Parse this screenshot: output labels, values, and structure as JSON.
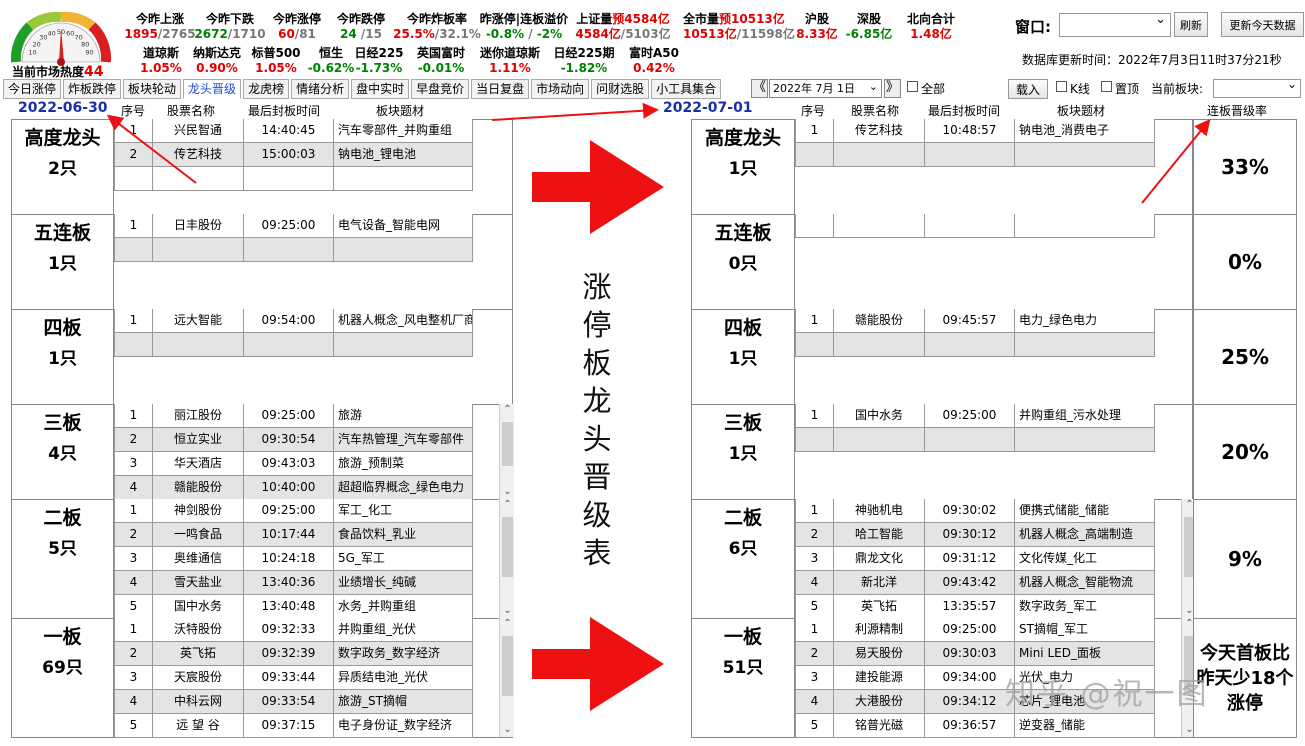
{
  "gauge": {
    "label": "当前市场热度",
    "value": "44",
    "ticks": [
      "10",
      "20",
      "30",
      "40",
      "50",
      "60",
      "70",
      "80",
      "90"
    ]
  },
  "stats_row1": [
    {
      "label": "今昨上涨",
      "a": "1895",
      "b": "2765",
      "sep": "/",
      "ac": "red",
      "bc": "gray"
    },
    {
      "label": "今昨下跌",
      "a": "2672",
      "b": "1710",
      "sep": "/",
      "ac": "green",
      "bc": "gray"
    },
    {
      "label": "今昨涨停",
      "a": "60",
      "b": "81",
      "sep": "/",
      "ac": "red",
      "bc": "gray"
    },
    {
      "label": "今昨跌停",
      "a": "24",
      "b": "15",
      "sep": " /",
      "ac": "green",
      "bc": "gray"
    },
    {
      "label": "今昨炸板率",
      "a": "25.5%",
      "b": "32.1%",
      "sep": "/",
      "ac": "red",
      "bc": "gray"
    },
    {
      "label": "昨涨停|连板溢价",
      "a": "-0.8%",
      "b": "-2%",
      "sep": " / ",
      "ac": "green",
      "bc": "green"
    },
    {
      "label": "上证量",
      "label2": "预4584亿",
      "a": "4584亿",
      "b": "5103亿",
      "sep": "/",
      "ac": "red",
      "bc": "gray"
    },
    {
      "label": "全市量",
      "label2": "预10513亿",
      "a": "10513亿",
      "b": "11598亿",
      "sep": "/",
      "ac": "red",
      "bc": "gray"
    },
    {
      "label": "沪股",
      "a": "8.33亿",
      "ac": "red"
    },
    {
      "label": "深股",
      "a": "-6.85亿",
      "ac": "green"
    },
    {
      "label": "北向合计",
      "a": "1.48亿",
      "ac": "red"
    }
  ],
  "stats_row2": [
    {
      "label": "道琼斯",
      "a": "1.05%",
      "ac": "red"
    },
    {
      "label": "纳斯达克",
      "a": "0.90%",
      "ac": "red"
    },
    {
      "label": "标普500",
      "a": "1.05%",
      "ac": "red"
    },
    {
      "label": "恒生",
      "a": "-0.62%",
      "ac": "green"
    },
    {
      "label": "日经225",
      "a": "-1.73%",
      "ac": "green"
    },
    {
      "label": "英国富时",
      "a": "-0.01%",
      "ac": "green"
    },
    {
      "label": "迷你道琼斯",
      "a": "1.11%",
      "ac": "red"
    },
    {
      "label": "日经225期",
      "a": "-1.82%",
      "ac": "green"
    },
    {
      "label": "富时A50",
      "a": "0.42%",
      "ac": "red"
    }
  ],
  "window": {
    "label": "窗口:",
    "refresh": "刷新",
    "update": "更新今天数据",
    "db_time": "数据库更新时间：2022年7月3日11时37分21秒"
  },
  "tabs": [
    "今日涨停",
    "炸板跌停",
    "板块轮动",
    "龙头晋级",
    "龙虎榜",
    "情绪分析",
    "盘中实时",
    "早盘竞价",
    "当日复盘",
    "市场动向",
    "问财选股",
    "小工具集合"
  ],
  "active_tab": "龙头晋级",
  "toolbar": {
    "date": "2022年 7月 1日",
    "all": "全部",
    "load": "载入",
    "kline": "K线",
    "pin": "置顶",
    "board": "当前板块:"
  },
  "headers": {
    "seq": "序号",
    "name": "股票名称",
    "time": "最后封板时间",
    "topic": "板块题材",
    "rate": "连板晋级率"
  },
  "title_chars": [
    "涨",
    "停",
    "板",
    "龙",
    "头",
    "晋",
    "级",
    "表"
  ],
  "left": {
    "date": "2022-06-30",
    "levels": [
      {
        "name": "高度龙头",
        "count": "2只",
        "rows": [
          [
            "1",
            "兴民智通",
            "14:40:45",
            "汽车零部件_并购重组"
          ],
          [
            "2",
            "传艺科技",
            "15:00:03",
            "钠电池_锂电池"
          ]
        ]
      },
      {
        "name": "五连板",
        "count": "1只",
        "rows": [
          [
            "1",
            "日丰股份",
            "09:25:00",
            "电气设备_智能电网"
          ]
        ]
      },
      {
        "name": "四板",
        "count": "1只",
        "rows": [
          [
            "1",
            "远大智能",
            "09:54:00",
            "机器人概念_风电整机厂商"
          ]
        ]
      },
      {
        "name": "三板",
        "count": "4只",
        "rows": [
          [
            "1",
            "丽江股份",
            "09:25:00",
            "旅游"
          ],
          [
            "2",
            "恒立实业",
            "09:30:54",
            "汽车热管理_汽车零部件"
          ],
          [
            "3",
            "华天酒店",
            "09:43:03",
            "旅游_预制菜"
          ],
          [
            "4",
            "赣能股份",
            "10:40:00",
            "超超临界概念_绿色电力"
          ]
        ]
      },
      {
        "name": "二板",
        "count": "5只",
        "rows": [
          [
            "1",
            "神剑股份",
            "09:25:00",
            "军工_化工"
          ],
          [
            "2",
            "一鸣食品",
            "10:17:44",
            "食品饮料_乳业"
          ],
          [
            "3",
            "奥维通信",
            "10:24:18",
            "5G_军工"
          ],
          [
            "4",
            "雪天盐业",
            "13:40:36",
            "业绩增长_纯碱"
          ],
          [
            "5",
            "国中水务",
            "13:40:48",
            "水务_并购重组"
          ]
        ]
      },
      {
        "name": "一板",
        "count": "69只",
        "rows": [
          [
            "1",
            "沃特股份",
            "09:32:33",
            "并购重组_光伏"
          ],
          [
            "2",
            "英飞拓",
            "09:32:39",
            "数字政务_数字经济"
          ],
          [
            "3",
            "天宸股份",
            "09:33:44",
            "异质结电池_光伏"
          ],
          [
            "4",
            "中科云网",
            "09:33:54",
            "旅游_ST摘帽"
          ],
          [
            "5",
            "远 望 谷",
            "09:37:15",
            "电子身份证_数字经济"
          ]
        ]
      }
    ]
  },
  "right": {
    "date": "2022-07-01",
    "levels": [
      {
        "name": "高度龙头",
        "count": "1只",
        "rate": "33%",
        "rows": [
          [
            "1",
            "传艺科技",
            "10:48:57",
            "钠电池_消费电子"
          ]
        ]
      },
      {
        "name": "五连板",
        "count": "0只",
        "rate": "0%",
        "rows": []
      },
      {
        "name": "四板",
        "count": "1只",
        "rate": "25%",
        "rows": [
          [
            "1",
            "赣能股份",
            "09:45:57",
            "电力_绿色电力"
          ]
        ]
      },
      {
        "name": "三板",
        "count": "1只",
        "rate": "20%",
        "rows": [
          [
            "1",
            "国中水务",
            "09:25:00",
            "并购重组_污水处理"
          ]
        ]
      },
      {
        "name": "二板",
        "count": "6只",
        "rate": "9%",
        "rows": [
          [
            "1",
            "神驰机电",
            "09:30:02",
            "便携式储能_储能"
          ],
          [
            "2",
            "哈工智能",
            "09:30:12",
            "机器人概念_高端制造"
          ],
          [
            "3",
            "鼎龙文化",
            "09:31:12",
            "文化传媒_化工"
          ],
          [
            "4",
            "新北洋",
            "09:43:42",
            "机器人概念_智能物流"
          ],
          [
            "5",
            "英飞拓",
            "13:35:57",
            "数字政务_军工"
          ]
        ]
      },
      {
        "name": "一板",
        "count": "51只",
        "rate": "今天首板比昨天少18个涨停",
        "rows": [
          [
            "1",
            "利源精制",
            "09:25:00",
            "ST摘帽_军工"
          ],
          [
            "2",
            "易天股份",
            "09:30:03",
            "Mini LED_面板"
          ],
          [
            "3",
            "建投能源",
            "09:34:00",
            "光伏_电力"
          ],
          [
            "4",
            "大港股份",
            "09:34:12",
            "芯片_锂电池"
          ],
          [
            "5",
            "铭普光磁",
            "09:36:57",
            "逆变器_储能"
          ]
        ]
      }
    ]
  },
  "watermark": "知乎 @祝一图",
  "colors": {
    "red": "#e00000",
    "green": "#008000",
    "date": "#1a2ea8",
    "arrow": "#ee1111"
  }
}
